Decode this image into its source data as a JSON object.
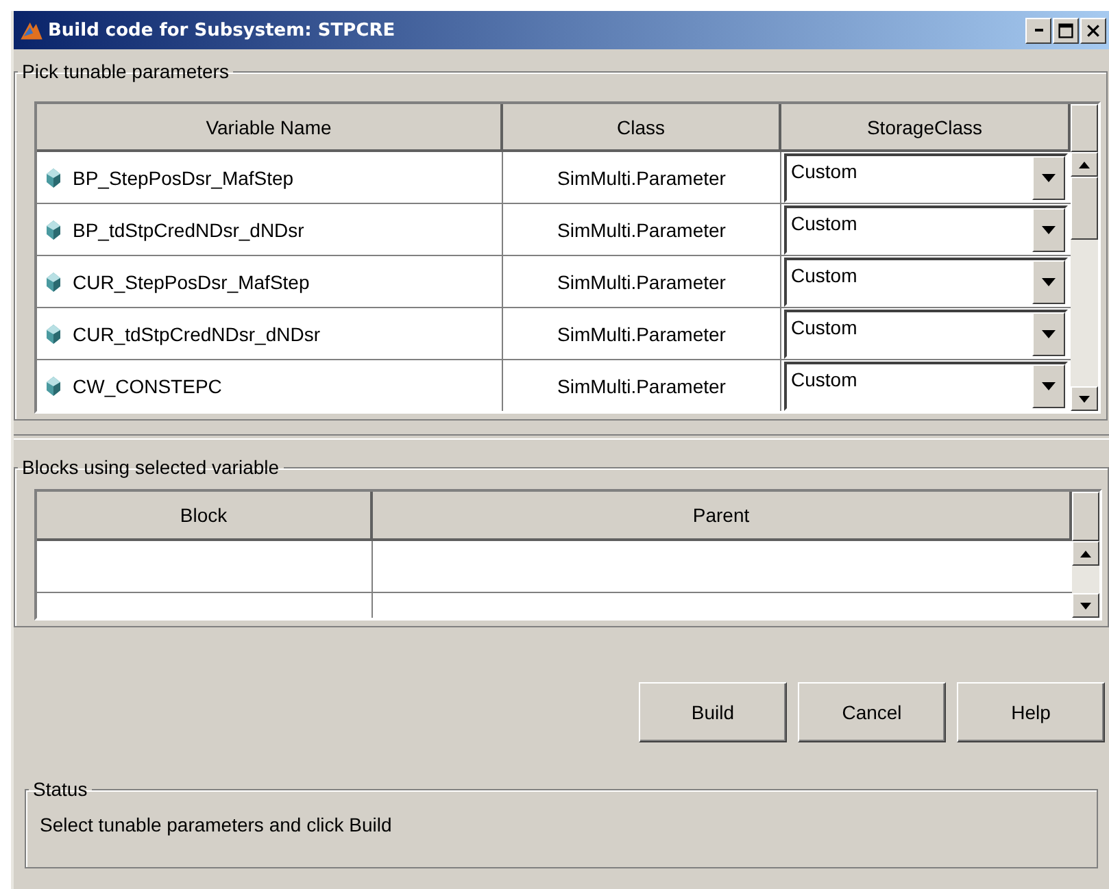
{
  "window": {
    "title": "Build code for Subsystem: STPCRE"
  },
  "parameters": {
    "title": "Pick tunable parameters",
    "columns": [
      "Variable Name",
      "Class",
      "StorageClass"
    ],
    "rows": [
      {
        "name": "BP_StepPosDsr_MafStep",
        "class": "SimMulti.Parameter",
        "storage_class": "Custom"
      },
      {
        "name": "BP_tdStpCredNDsr_dNDsr",
        "class": "SimMulti.Parameter",
        "storage_class": "Custom"
      },
      {
        "name": "CUR_StepPosDsr_MafStep",
        "class": "SimMulti.Parameter",
        "storage_class": "Custom"
      },
      {
        "name": "CUR_tdStpCredNDsr_dNDsr",
        "class": "SimMulti.Parameter",
        "storage_class": "Custom"
      },
      {
        "name": "CW_CONSTEPC",
        "class": "SimMulti.Parameter",
        "storage_class": "Custom"
      }
    ]
  },
  "blocks": {
    "title": "Blocks using selected variable",
    "columns": [
      "Block",
      "Parent"
    ]
  },
  "buttons": [
    "Build",
    "Cancel",
    "Help"
  ],
  "status": {
    "title": "Status",
    "message": "Select tunable parameters and click Build"
  }
}
